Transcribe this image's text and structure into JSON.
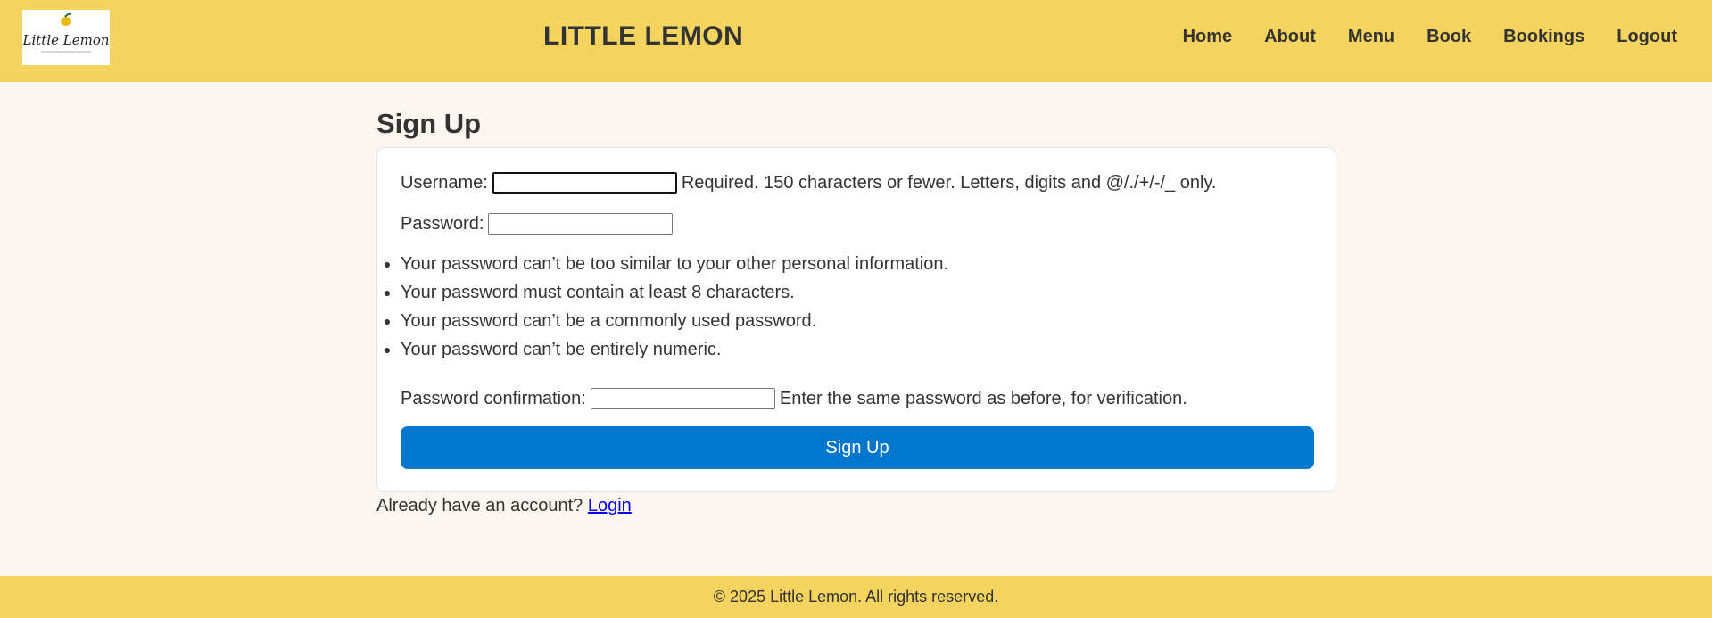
{
  "header": {
    "site_title": "LITTLE LEMON",
    "logo_text": "Little Lemon",
    "nav": [
      {
        "label": "Home"
      },
      {
        "label": "About"
      },
      {
        "label": "Menu"
      },
      {
        "label": "Book"
      },
      {
        "label": "Bookings"
      },
      {
        "label": "Logout"
      }
    ]
  },
  "page": {
    "heading": "Sign Up"
  },
  "form": {
    "username_label": "Username:",
    "username_value": "",
    "username_help": "Required. 150 characters or fewer. Letters, digits and @/./+/-/_ only.",
    "password_label": "Password:",
    "password_value": "",
    "password_rules": [
      "Your password can’t be too similar to your other personal information.",
      "Your password must contain at least 8 characters.",
      "Your password can’t be a commonly used password.",
      "Your password can’t be entirely numeric."
    ],
    "confirm_label": "Password confirmation:",
    "confirm_value": "",
    "confirm_help": "Enter the same password as before, for verification.",
    "submit_label": "Sign Up"
  },
  "login_prompt": {
    "text": "Already have an account?",
    "link_label": "Login"
  },
  "footer": {
    "text": "© 2025 Little Lemon. All rights reserved."
  },
  "colors": {
    "header_bg": "#f4d35e",
    "page_bg": "#fdf6f0",
    "button_bg": "#0077cc",
    "link": "#0000ee"
  }
}
